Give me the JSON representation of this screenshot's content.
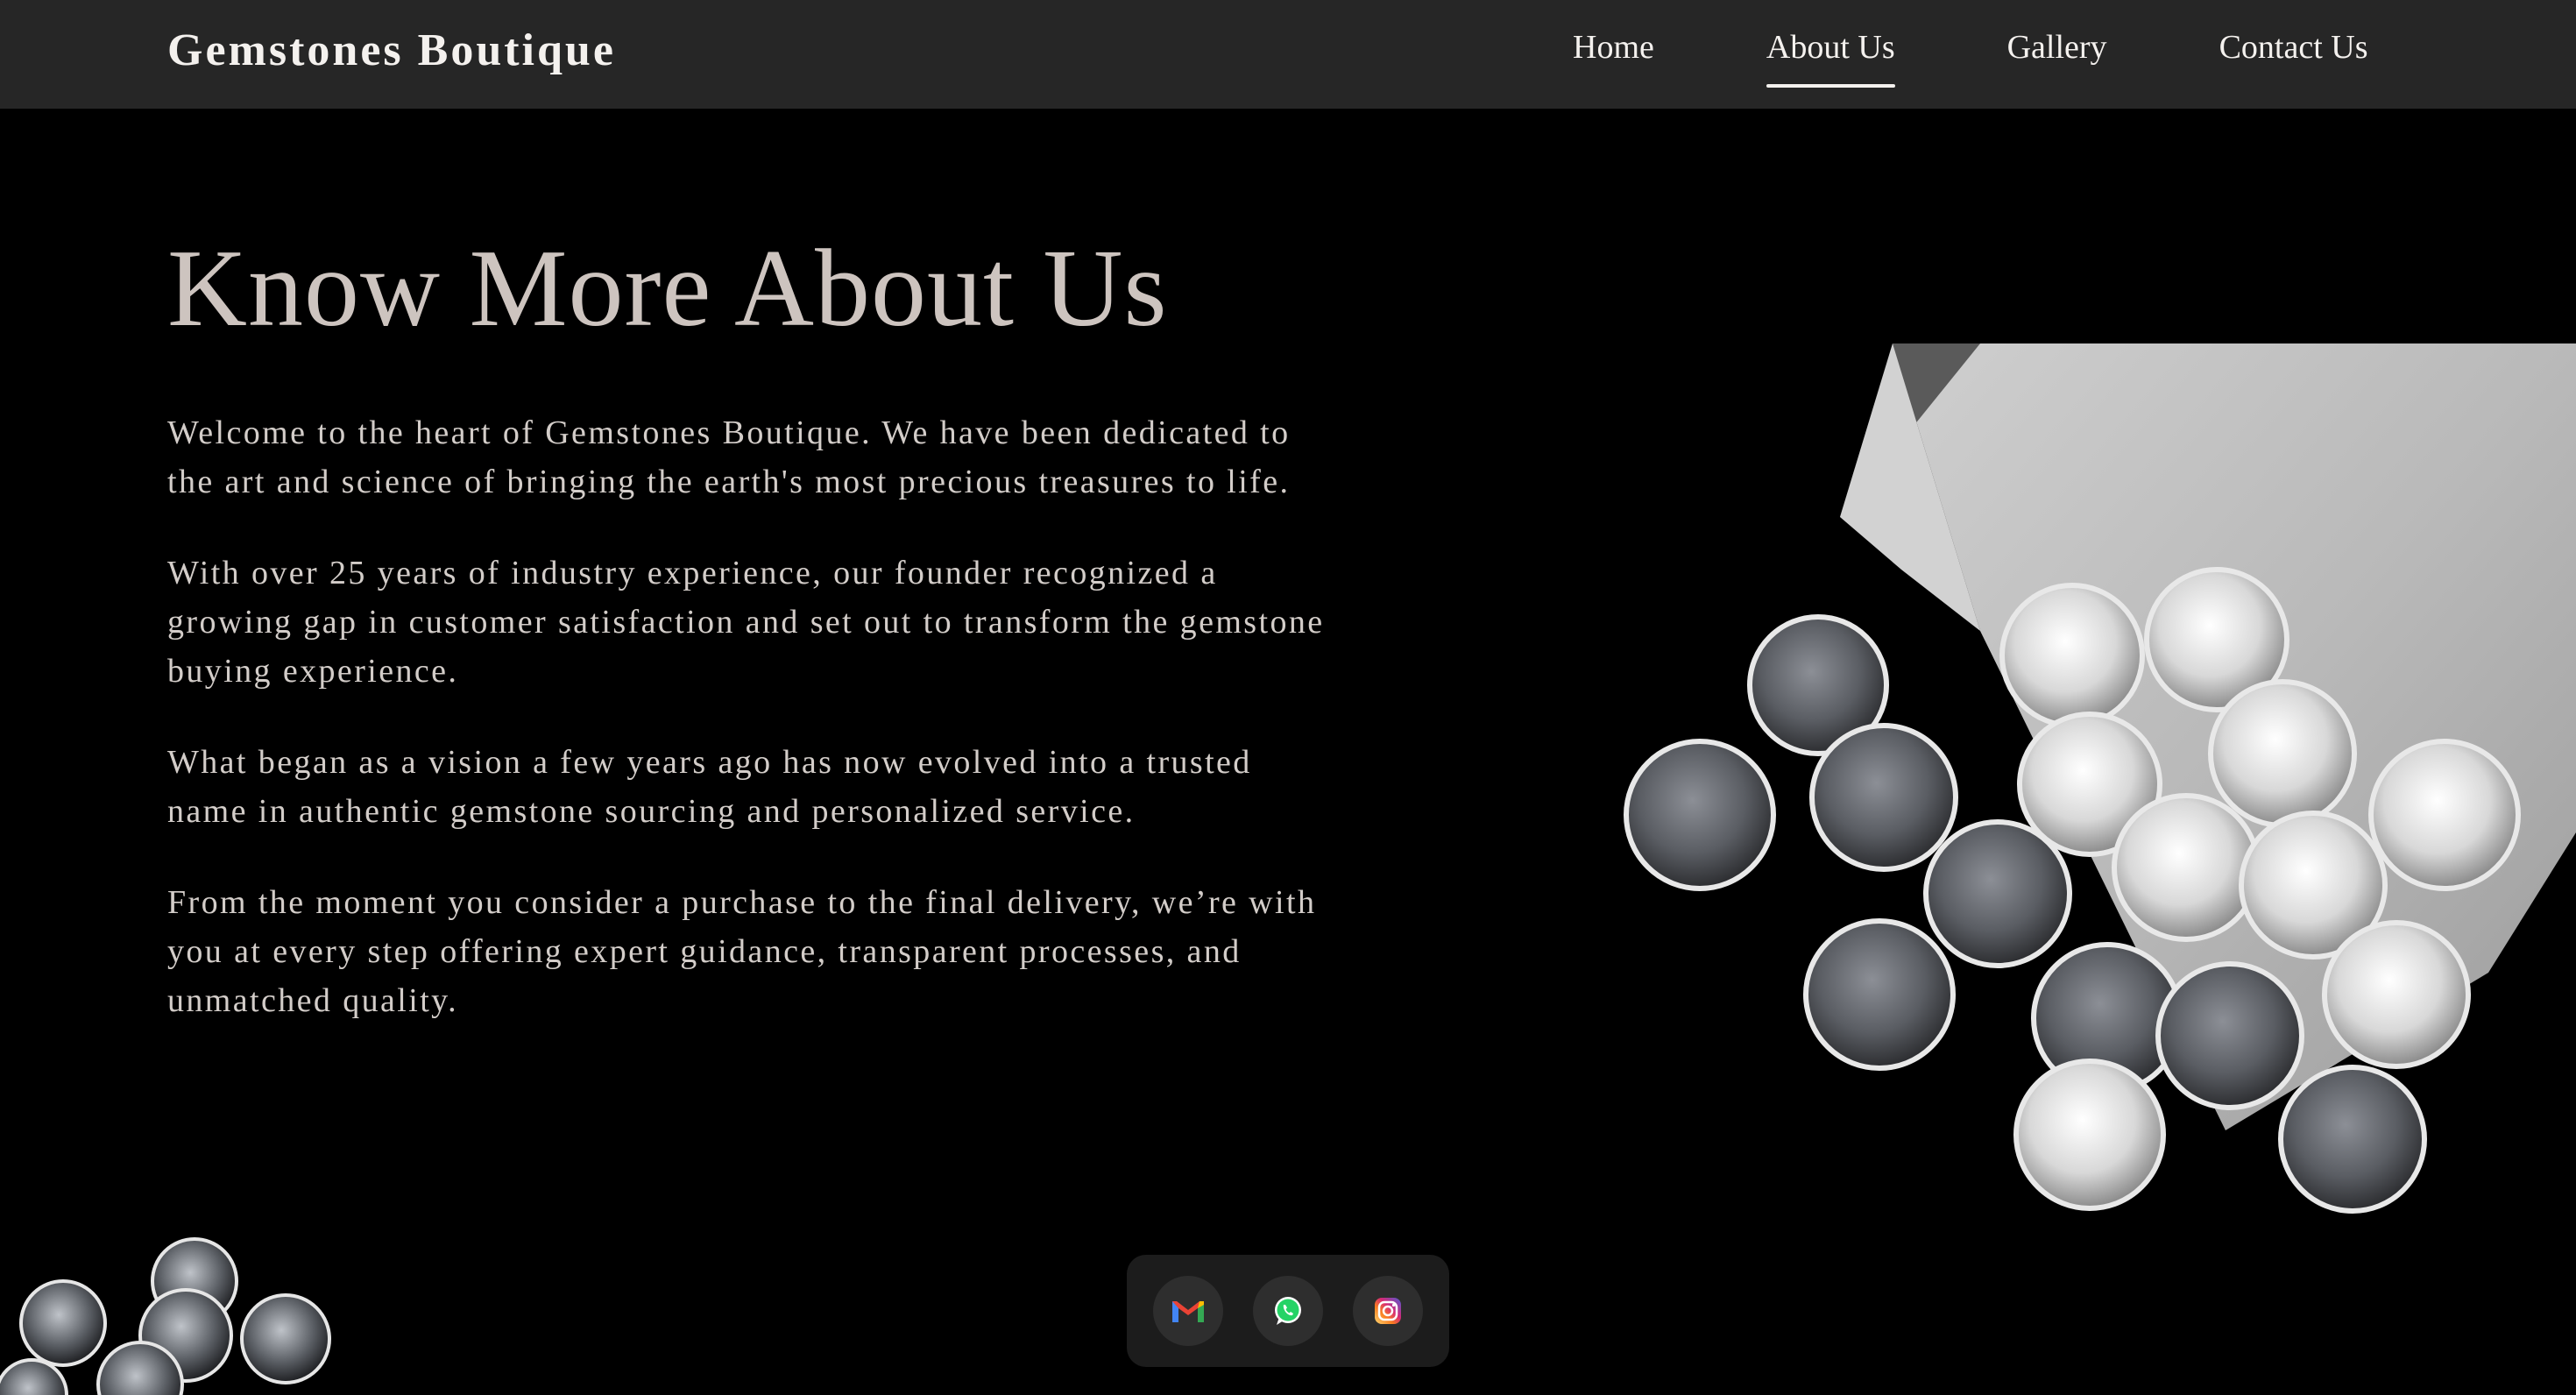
{
  "navbar": {
    "brand": "Gemstones Boutique",
    "links": [
      {
        "label": "Home",
        "active": false
      },
      {
        "label": "About Us",
        "active": true
      },
      {
        "label": "Gallery",
        "active": false
      },
      {
        "label": "Contact Us",
        "active": false
      }
    ]
  },
  "main": {
    "heading": "Know More About Us",
    "paragraphs": [
      "Welcome to the heart of Gemstones Boutique. We have been dedicated to the art and science of bringing the earth's most precious treasures to life.",
      "With over 25 years of industry experience, our founder recognized a growing gap in customer satisfaction and set out to transform the gemstone buying experience.",
      "What began as a vision a few years ago has now evolved into a trusted name in authentic gemstone sourcing and personalized service.",
      "From the moment you consider a purchase to the final delivery, we’re with you at every step offering expert guidance, transparent processes, and unmatched quality."
    ]
  },
  "social": {
    "icons": [
      "gmail-icon",
      "whatsapp-icon",
      "instagram-icon"
    ]
  },
  "colors": {
    "navbar_bg": "#262626",
    "page_bg": "#000000",
    "heading": "#cdc4bf",
    "body_text": "#d3cdc9",
    "social_bar_bg": "#1c1c1c"
  }
}
